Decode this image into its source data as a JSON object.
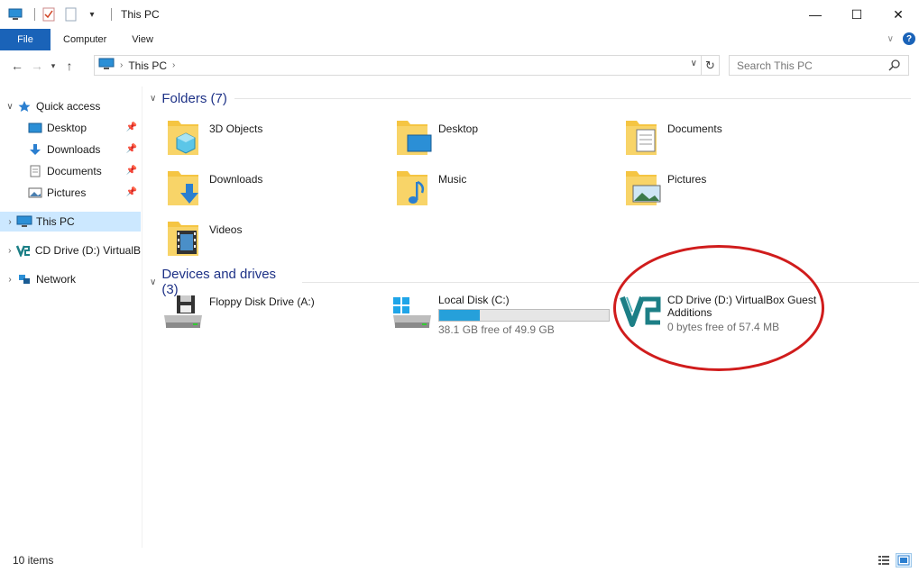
{
  "window": {
    "title": "This PC",
    "controls": {
      "minimize": "—",
      "maximize": "☐",
      "close": "✕"
    }
  },
  "ribbon": {
    "tabs": [
      "File",
      "Computer",
      "View"
    ],
    "help": "?"
  },
  "address": {
    "crumbs": [
      "This PC"
    ]
  },
  "search": {
    "placeholder": "Search This PC"
  },
  "nav": {
    "quick_access": "Quick access",
    "quick_items": [
      "Desktop",
      "Downloads",
      "Documents",
      "Pictures"
    ],
    "this_pc": "This PC",
    "cd_drive": "CD Drive (D:) VirtualB",
    "network": "Network"
  },
  "folders": {
    "header": "Folders (7)",
    "items": [
      "3D Objects",
      "Desktop",
      "Documents",
      "Downloads",
      "Music",
      "Pictures",
      "Videos"
    ]
  },
  "devices": {
    "header": "Devices and drives (3)",
    "floppy": {
      "name": "Floppy Disk Drive (A:)"
    },
    "local": {
      "name": "Local Disk (C:)",
      "free_text": "38.1 GB free of 49.9 GB",
      "used_fraction": 0.24
    },
    "cd": {
      "name_line1": "CD Drive (D:) VirtualBox Guest",
      "name_line2": "Additions",
      "free_text": "0 bytes free of 57.4 MB"
    }
  },
  "status": {
    "count": "10 items"
  },
  "colors": {
    "accent": "#1a63b8",
    "folder": "#f5c542",
    "selection": "#cce8ff",
    "annotation": "#d01c1c",
    "drive_bar": "#26a0da"
  }
}
